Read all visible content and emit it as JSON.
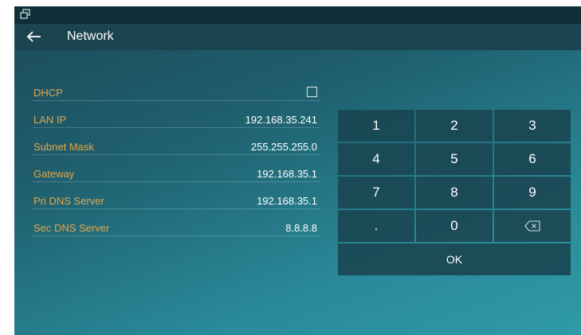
{
  "header": {
    "title": "Network"
  },
  "fields": [
    {
      "label": "DHCP",
      "checked": false
    },
    {
      "label": "LAN IP",
      "value": "192.168.35.241"
    },
    {
      "label": "Subnet Mask",
      "value": "255.255.255.0"
    },
    {
      "label": "Gateway",
      "value": "192.168.35.1"
    },
    {
      "label": "Pri DNS Server",
      "value": "192.168.35.1"
    },
    {
      "label": "Sec DNS Server",
      "value": "8.8.8.8"
    }
  ],
  "keypad": {
    "keys": [
      "1",
      "2",
      "3",
      "4",
      "5",
      "6",
      "7",
      "8",
      "9",
      ".",
      "0"
    ],
    "backspace_icon": "backspace-icon",
    "ok_label": "OK"
  },
  "icons": {
    "status": "window-restore-icon",
    "back": "back-arrow-icon"
  },
  "colors": {
    "label": "#e3a64a",
    "value": "#ffffff",
    "key_bg": "#1a4652"
  }
}
